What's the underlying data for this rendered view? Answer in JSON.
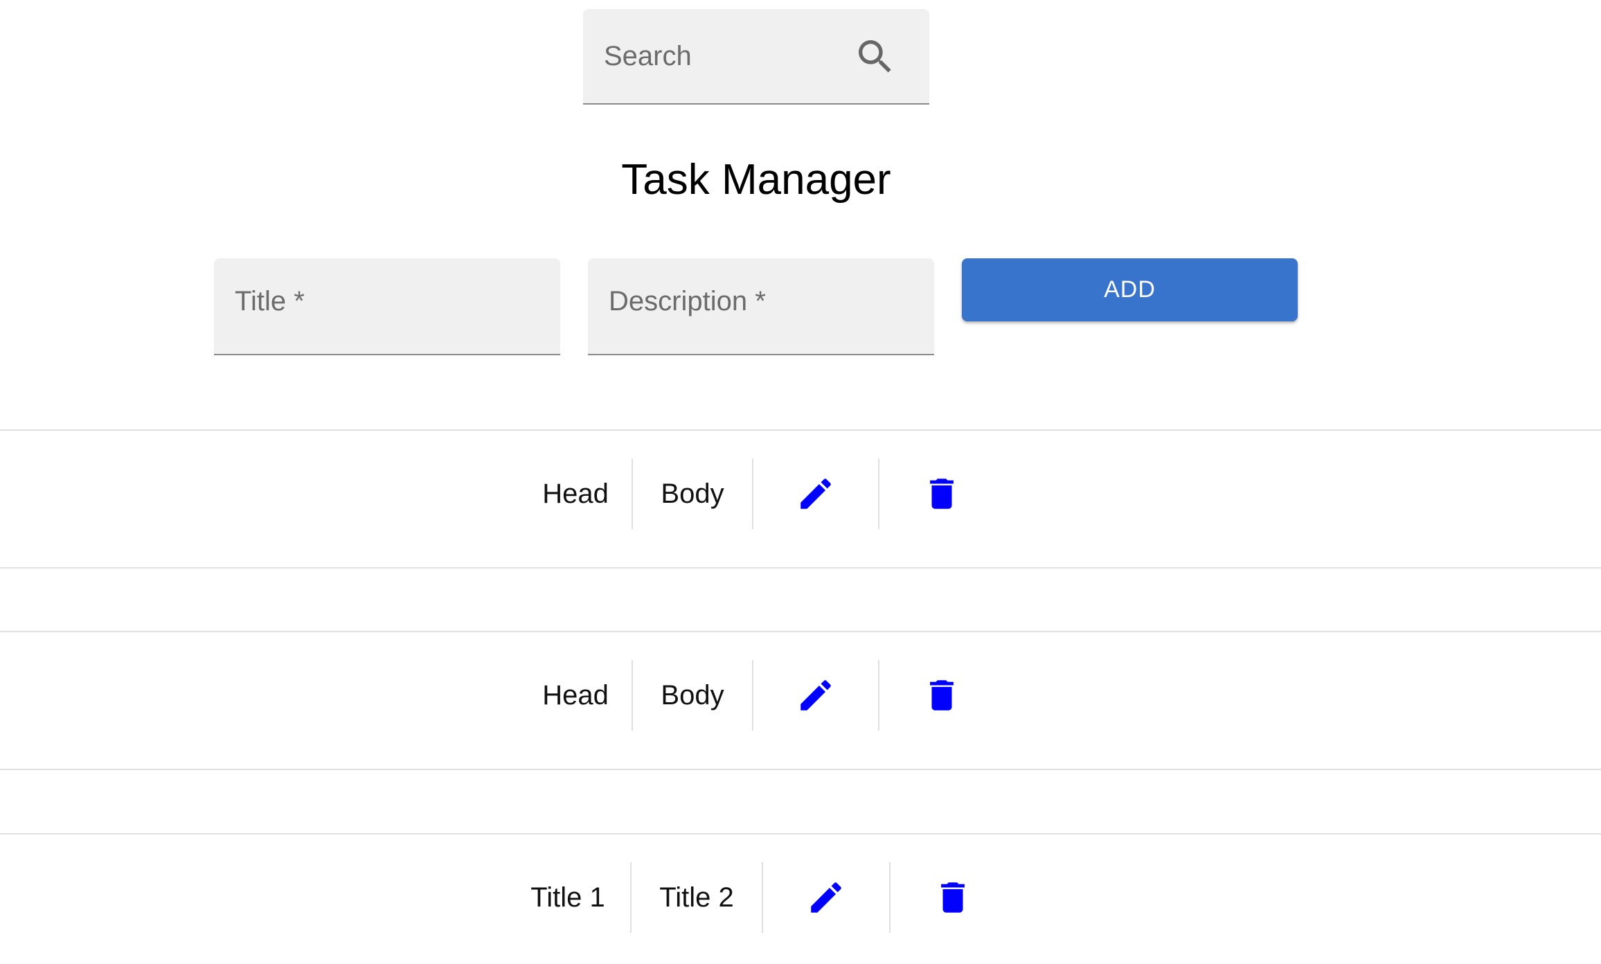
{
  "search": {
    "placeholder": "Search",
    "icon": "search-icon"
  },
  "title": "Task Manager",
  "form": {
    "title_label": "Title *",
    "description_label": "Description *",
    "add_label": "ADD"
  },
  "tasks": [
    {
      "title": "Head",
      "description": "Body"
    },
    {
      "title": "Head",
      "description": "Body"
    },
    {
      "title": "Title 1",
      "description": "Title 2"
    }
  ],
  "colors": {
    "accent": "#3874cb",
    "icon": "#0000ff",
    "field_bg": "#f0f0f0"
  },
  "icons": {
    "edit": "pencil-icon",
    "delete": "trash-icon"
  }
}
